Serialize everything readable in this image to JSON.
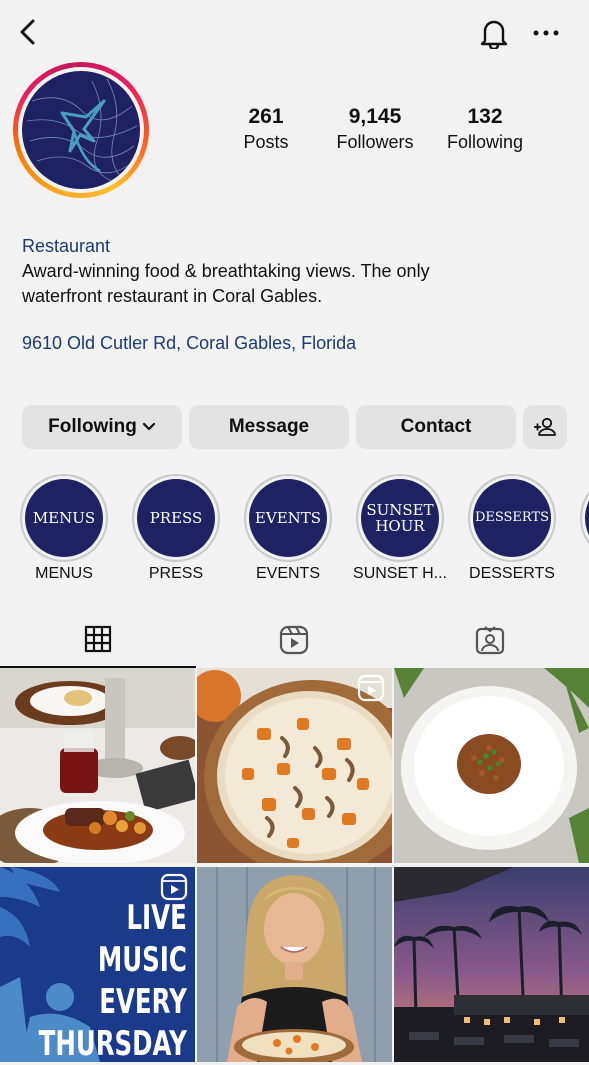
{
  "profile": {
    "stats": [
      {
        "value": "261",
        "label": "Posts"
      },
      {
        "value": "9,145",
        "label": "Followers"
      },
      {
        "value": "132",
        "label": "Following"
      }
    ],
    "category": "Restaurant",
    "bio_line1": "Award-winning food & breathtaking views. The only",
    "bio_line2": "waterfront restaurant in Coral Gables.",
    "address": "9610 Old Cutler Rd, Coral Gables, Florida"
  },
  "actions": {
    "following": "Following",
    "message": "Message",
    "contact": "Contact"
  },
  "highlights": [
    {
      "cover": "MENUS",
      "label": "MENUS"
    },
    {
      "cover": "PRESS",
      "label": "PRESS"
    },
    {
      "cover": "EVENTS",
      "label": "EVENTS"
    },
    {
      "cover_line1": "SUNSET",
      "cover_line2": "HOUR",
      "label": "SUNSET H..."
    },
    {
      "cover": "DESSERTS",
      "label": "DESSERTS"
    }
  ],
  "tabs": [
    "grid-icon",
    "reels-icon",
    "tagged-icon"
  ],
  "posts": {
    "live_music_lines": [
      "LIVE MUSIC",
      "EVERY",
      "THURSDAY"
    ]
  },
  "colors": {
    "brand_navy": "#1f2262",
    "link_blue": "#1d3b6e",
    "button_gray": "#e3e3e3",
    "background": "#f2f2f2"
  }
}
